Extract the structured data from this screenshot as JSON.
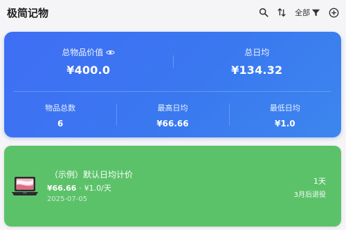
{
  "header": {
    "title": "极简记物",
    "filter_label": "全部"
  },
  "summary": {
    "total_value_label": "总物品价值",
    "total_value": "¥400.0",
    "daily_total_label": "总日均",
    "daily_total": "¥134.32",
    "item_count_label": "物品总数",
    "item_count": "6",
    "max_daily_label": "最高日均",
    "max_daily": "¥66.66",
    "min_daily_label": "最低日均",
    "min_daily": "¥1.0"
  },
  "items": [
    {
      "name": "（示例）默认日均计价",
      "price": "¥66.66",
      "separator": "·",
      "daily": "¥1.0/天",
      "date": "2025-07-05",
      "days": "1天",
      "retire_note": "3月后退役",
      "card_color": "#5cc26a",
      "icon": "laptop-icon"
    }
  ],
  "colors": {
    "primary_card": "#3f6ef4",
    "item_card": "#5cc26a"
  }
}
